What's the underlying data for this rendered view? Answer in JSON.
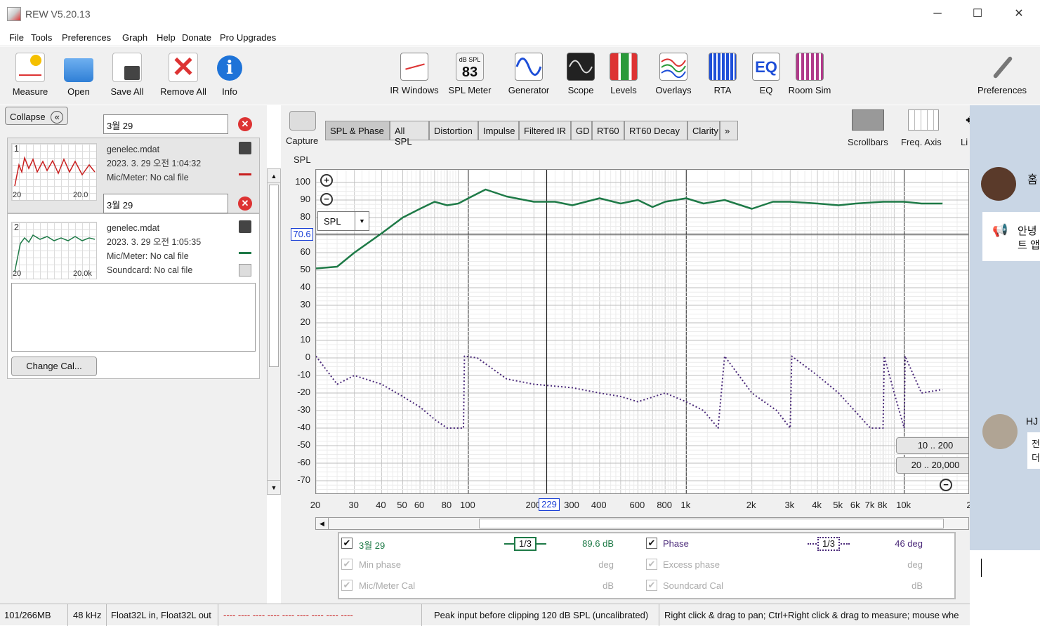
{
  "window": {
    "title": "REW V5.20.13",
    "controls": [
      "─",
      "☐",
      "✕"
    ]
  },
  "menu": [
    "File",
    "Tools",
    "Preferences",
    "Graph",
    "Help",
    "Donate",
    "Pro Upgrades"
  ],
  "toolbar": {
    "left": [
      "Measure",
      "Open",
      "Save All",
      "Remove All",
      "Info"
    ],
    "center": [
      "IR Windows",
      "SPL Meter",
      "Generator",
      "Scope",
      "Levels",
      "Overlays",
      "RTA",
      "EQ",
      "Room Sim"
    ],
    "right": "Preferences",
    "spl_meter_unit": "dB SPL",
    "spl_meter_value": "83",
    "eq_icon_text": "EQ"
  },
  "left_panel": {
    "collapse_label": "Collapse",
    "collapse_glyph": "«",
    "change_cal_label": "Change Cal...",
    "measurements": [
      {
        "index": "1",
        "name": "3월 29",
        "file": "genelec.mdat",
        "date": "2023. 3. 29 오전 1:04:32",
        "cal1": "Mic/Meter: No cal file",
        "cal2": "",
        "thumb_left": "20",
        "thumb_right": "20.0"
      },
      {
        "index": "2",
        "name": "3월 29",
        "file": "genelec.mdat",
        "date": "2023. 3. 29 오전 1:05:35",
        "cal1": "Mic/Meter: No cal file",
        "cal2": "Soundcard: No cal file",
        "thumb_left": "20",
        "thumb_right": "20.0k"
      }
    ]
  },
  "graph": {
    "capture_label": "Capture",
    "tabs": [
      "SPL & Phase",
      "All SPL",
      "Distortion",
      "Impulse",
      "Filtered IR",
      "GD",
      "RT60",
      "RT60 Decay",
      "Clarity",
      "»"
    ],
    "right_tools": [
      "Scrollbars",
      "Freq. Axis",
      "Li"
    ],
    "y_axis_title": "SPL",
    "dropdown_value": "SPL",
    "cursor_y_label": "70.6",
    "cursor_x_label": "229",
    "range_buttons": [
      "10 .. 200",
      "20 .. 20,000"
    ],
    "zoom_in": "+",
    "zoom_out": "−"
  },
  "chart_data": {
    "type": "line",
    "xscale": "log",
    "xlim": [
      20,
      20000
    ],
    "ylim": [
      -75,
      105
    ],
    "ylabel": "SPL",
    "y_ticks": [
      "100",
      "90",
      "80",
      "70",
      "60",
      "50",
      "40",
      "30",
      "20",
      "10",
      "0",
      "-10",
      "-20",
      "-30",
      "-40",
      "-50",
      "-60",
      "-70"
    ],
    "x_ticks": [
      "20",
      "30",
      "40",
      "50",
      "60",
      "80",
      "100",
      "200",
      "300",
      "400",
      "600",
      "800",
      "1k",
      "2k",
      "3k",
      "4k",
      "5k",
      "6k",
      "7k",
      "8k",
      "10k",
      "2"
    ],
    "series": [
      {
        "name": "3월 29",
        "color": "#1e7a47",
        "x": [
          20,
          25,
          30,
          40,
          50,
          60,
          70,
          80,
          90,
          100,
          120,
          150,
          200,
          250,
          300,
          400,
          500,
          600,
          700,
          800,
          1000,
          1200,
          1500,
          2000,
          2500,
          3000,
          4000,
          5000,
          6000,
          8000,
          10000,
          12000,
          15000
        ],
        "y": [
          51,
          52,
          60,
          71,
          80,
          85,
          89,
          87,
          88,
          91,
          96,
          92,
          89,
          89,
          87,
          91,
          88,
          90,
          86,
          89,
          91,
          88,
          90,
          85,
          89,
          89,
          88,
          87,
          88,
          89,
          89,
          88,
          88
        ]
      },
      {
        "name": "Phase",
        "color": "#4b2a7a",
        "style": "dotted",
        "x": [
          20,
          25,
          30,
          40,
          50,
          60,
          70,
          80,
          90,
          95,
          96,
          110,
          150,
          200,
          300,
          400,
          500,
          600,
          800,
          1000,
          1200,
          1400,
          1500,
          2000,
          2600,
          3000,
          3050,
          4000,
          5000,
          7000,
          8000,
          8100,
          9000,
          10000,
          10100,
          12000,
          15000
        ],
        "y": [
          1,
          -15,
          -10,
          -15,
          -22,
          -28,
          -35,
          -40,
          -40,
          -40,
          1,
          0,
          -12,
          -15,
          -17,
          -20,
          -22,
          -25,
          -20,
          -25,
          -30,
          -40,
          1,
          -20,
          -30,
          -40,
          1,
          -10,
          -20,
          -40,
          -40,
          1,
          -20,
          -40,
          1,
          -20,
          -18
        ]
      }
    ]
  },
  "legend": {
    "rows": [
      {
        "left_label": "3월 29",
        "left_value": "89.6 dB",
        "right_label": "Phase",
        "right_value": "46 deg",
        "enabled": true
      },
      {
        "left_label": "Min phase",
        "left_value": "deg",
        "right_label": "Excess phase",
        "right_value": "deg",
        "enabled": false
      },
      {
        "left_label": "Mic/Meter Cal",
        "left_value": "dB",
        "right_label": "Soundcard Cal",
        "right_value": "dB",
        "enabled": false
      }
    ],
    "smoothing": "1/3"
  },
  "status": [
    "101/266MB",
    "48 kHz",
    "Float32L in, Float32L out",
    "---- ---- ---- ---- ---- ---- ---- ---- ----",
    "Peak input before clipping 120 dB SPL (uncalibrated)",
    "Right click & drag to pan; Ctrl+Right click & drag to measure; mouse whe"
  ],
  "right_panel": {
    "text1": "홈",
    "text2": "안녕",
    "text3": "트 앱",
    "text4": "HJ",
    "text5": "전",
    "text6": "더"
  },
  "colors": {
    "spl": "#1e7a47",
    "phase": "#4b2a7a",
    "cursor": "#1a3fd6",
    "close": "#d33333"
  }
}
